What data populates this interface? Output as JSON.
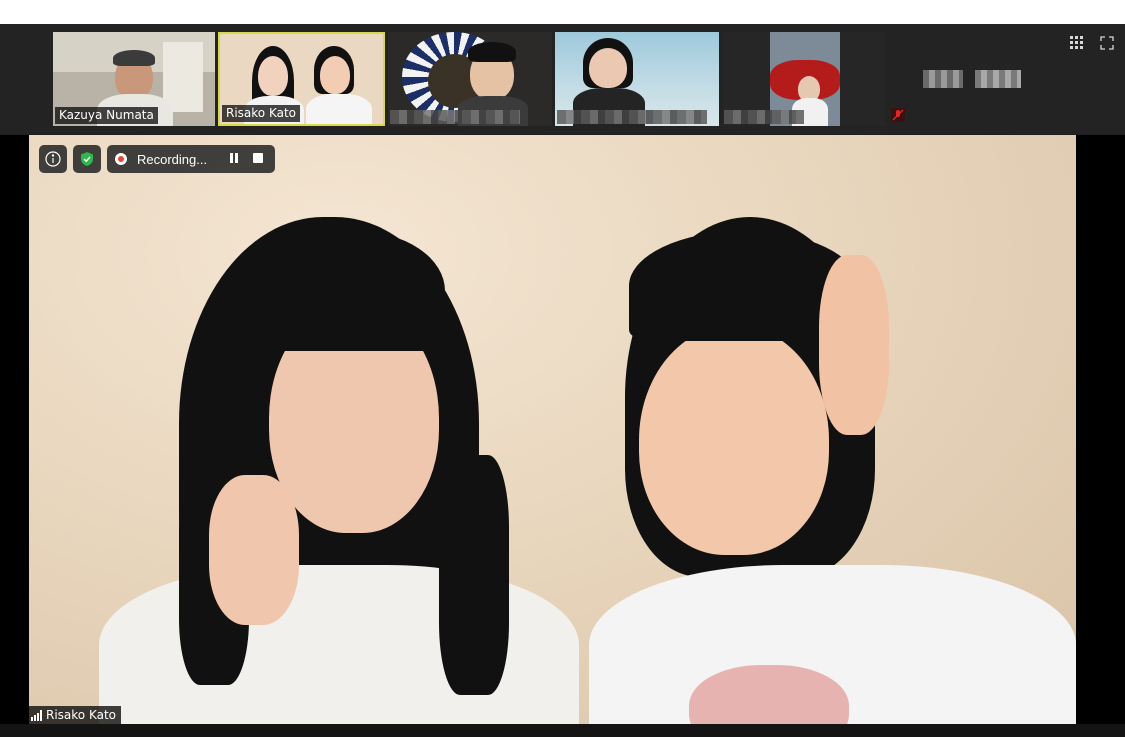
{
  "thumbnails": [
    {
      "name": "Kazuya Numata",
      "active": false
    },
    {
      "name": "Risako Kato",
      "active": true
    },
    {
      "name": "",
      "active": false
    },
    {
      "name": "",
      "active": false
    },
    {
      "name": "",
      "active": false
    },
    {
      "name": "",
      "active": false
    }
  ],
  "view_controls": {
    "grid_icon": "grid-view-icon",
    "fullscreen_icon": "fullscreen-icon"
  },
  "recording": {
    "label": "Recording...",
    "info_icon": "info-icon",
    "shield_icon": "shield-check-icon"
  },
  "main_speaker": {
    "name": "Risako Kato"
  },
  "colors": {
    "active_border": "#d7d84a",
    "record_red": "#e8453c",
    "shield_green": "#2eb84c",
    "muted_red": "#e02828"
  }
}
